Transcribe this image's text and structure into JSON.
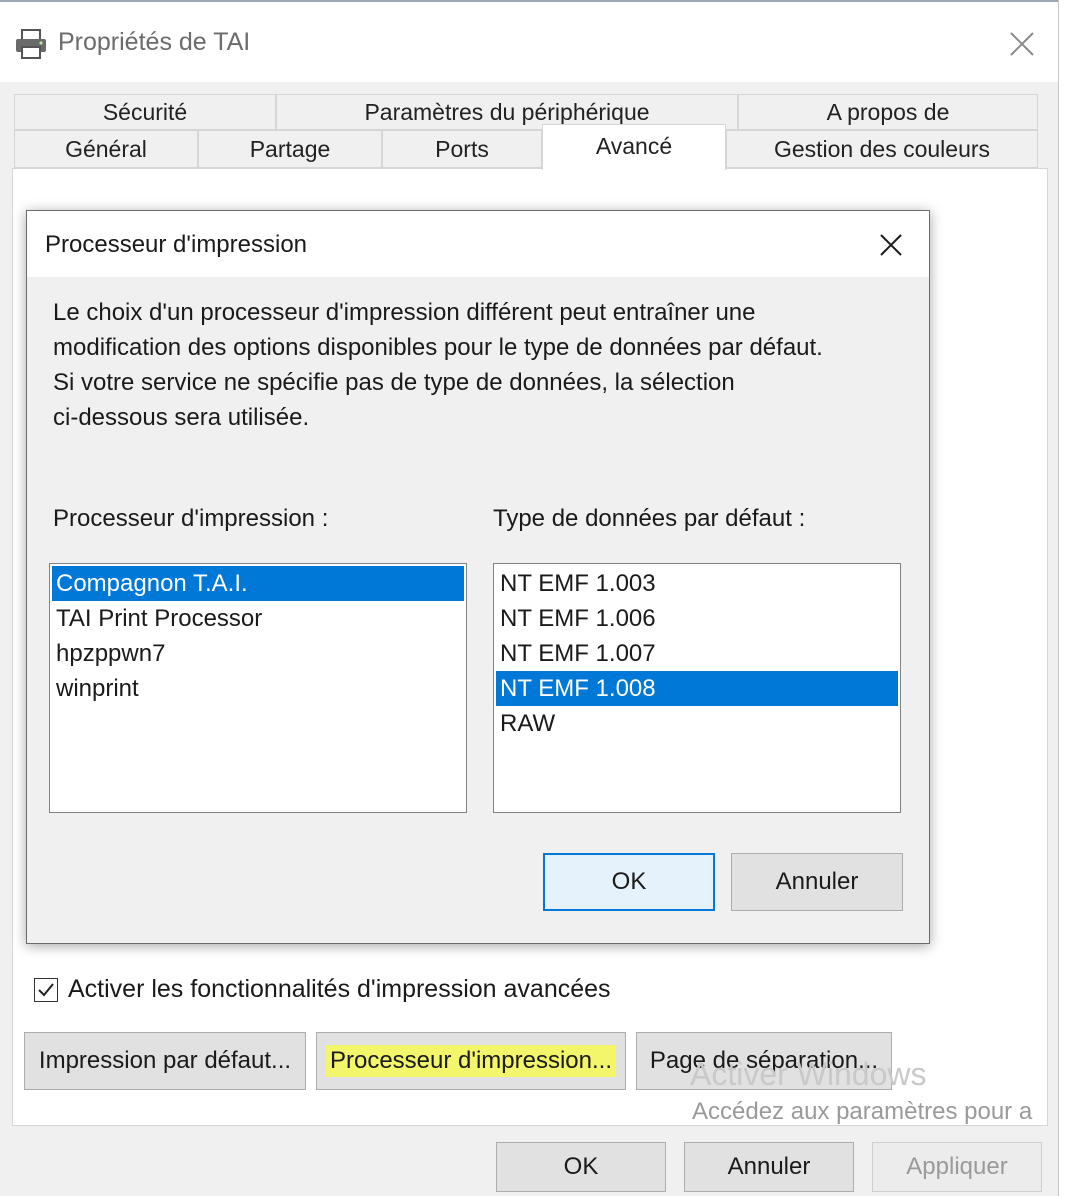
{
  "window": {
    "title": "Propriétés de TAI",
    "title_icon": "printer-icon",
    "close_icon": "close-icon"
  },
  "tabs": {
    "row1": [
      "Sécurité",
      "Paramètres du périphérique",
      "A propos de"
    ],
    "row2": [
      "Général",
      "Partage",
      "Ports",
      "Avancé",
      "Gestion des couleurs"
    ],
    "active": "Avancé"
  },
  "advanced": {
    "checkbox_label": "Activer les fonctionnalités d'impression avancées",
    "checkbox_checked": true,
    "buttons": {
      "default_print": "Impression par défaut...",
      "print_processor": "Processeur d'impression...",
      "separator_page": "Page de séparation..."
    },
    "highlight_color": "#f3f56a"
  },
  "footer": {
    "ok": "OK",
    "cancel": "Annuler",
    "apply": "Appliquer"
  },
  "watermark": {
    "line1": "Activer Windows",
    "line2": "Accédez aux paramètres pour a"
  },
  "dialog": {
    "title": "Processeur d'impression",
    "description": [
      "Le choix d'un processeur d'impression différent peut entraîner une",
      "modification des options disponibles pour le type de données par défaut.",
      "Si votre service ne spécifie pas de type de données, la sélection",
      "ci-dessous sera utilisée."
    ],
    "processor_label": "Processeur d'impression :",
    "datatype_label": "Type de données par défaut :",
    "processors": [
      "Compagnon T.A.I.",
      "TAI Print Processor",
      "hpzppwn7",
      "winprint"
    ],
    "selected_processor": "Compagnon T.A.I.",
    "datatypes": [
      "NT EMF 1.003",
      "NT EMF 1.006",
      "NT EMF 1.007",
      "NT EMF 1.008",
      "RAW"
    ],
    "selected_datatype": "NT EMF 1.008",
    "ok": "OK",
    "cancel": "Annuler",
    "accent_color": "#0078d7"
  }
}
